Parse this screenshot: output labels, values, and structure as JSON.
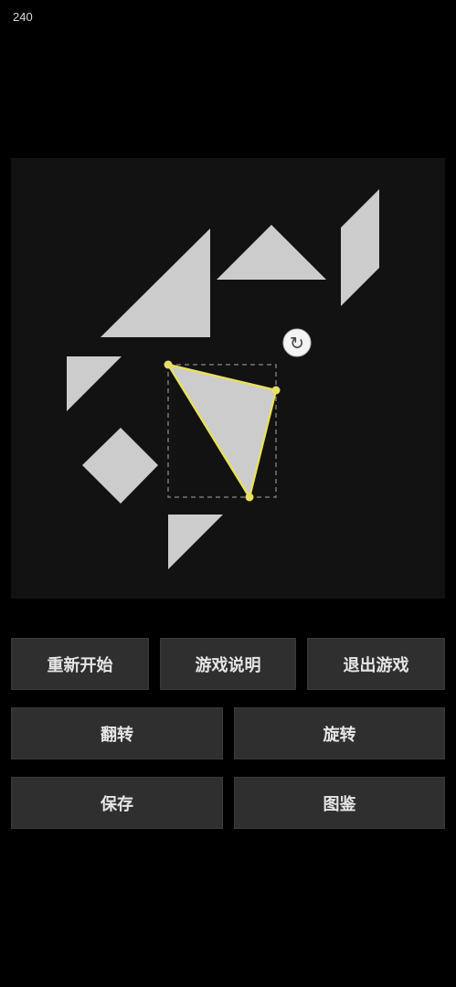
{
  "status": {
    "score": "240"
  },
  "board": {
    "piece_color": "#cccccc",
    "selected_outline_color": "#e8e060",
    "rotate_handle_icon": "rotate-cw-icon",
    "rotate_handle_glyph": "↻"
  },
  "buttons": {
    "restart": "重新开始",
    "instructions": "游戏说明",
    "exit": "退出游戏",
    "flip": "翻转",
    "rotate": "旋转",
    "save": "保存",
    "gallery": "图鉴"
  }
}
